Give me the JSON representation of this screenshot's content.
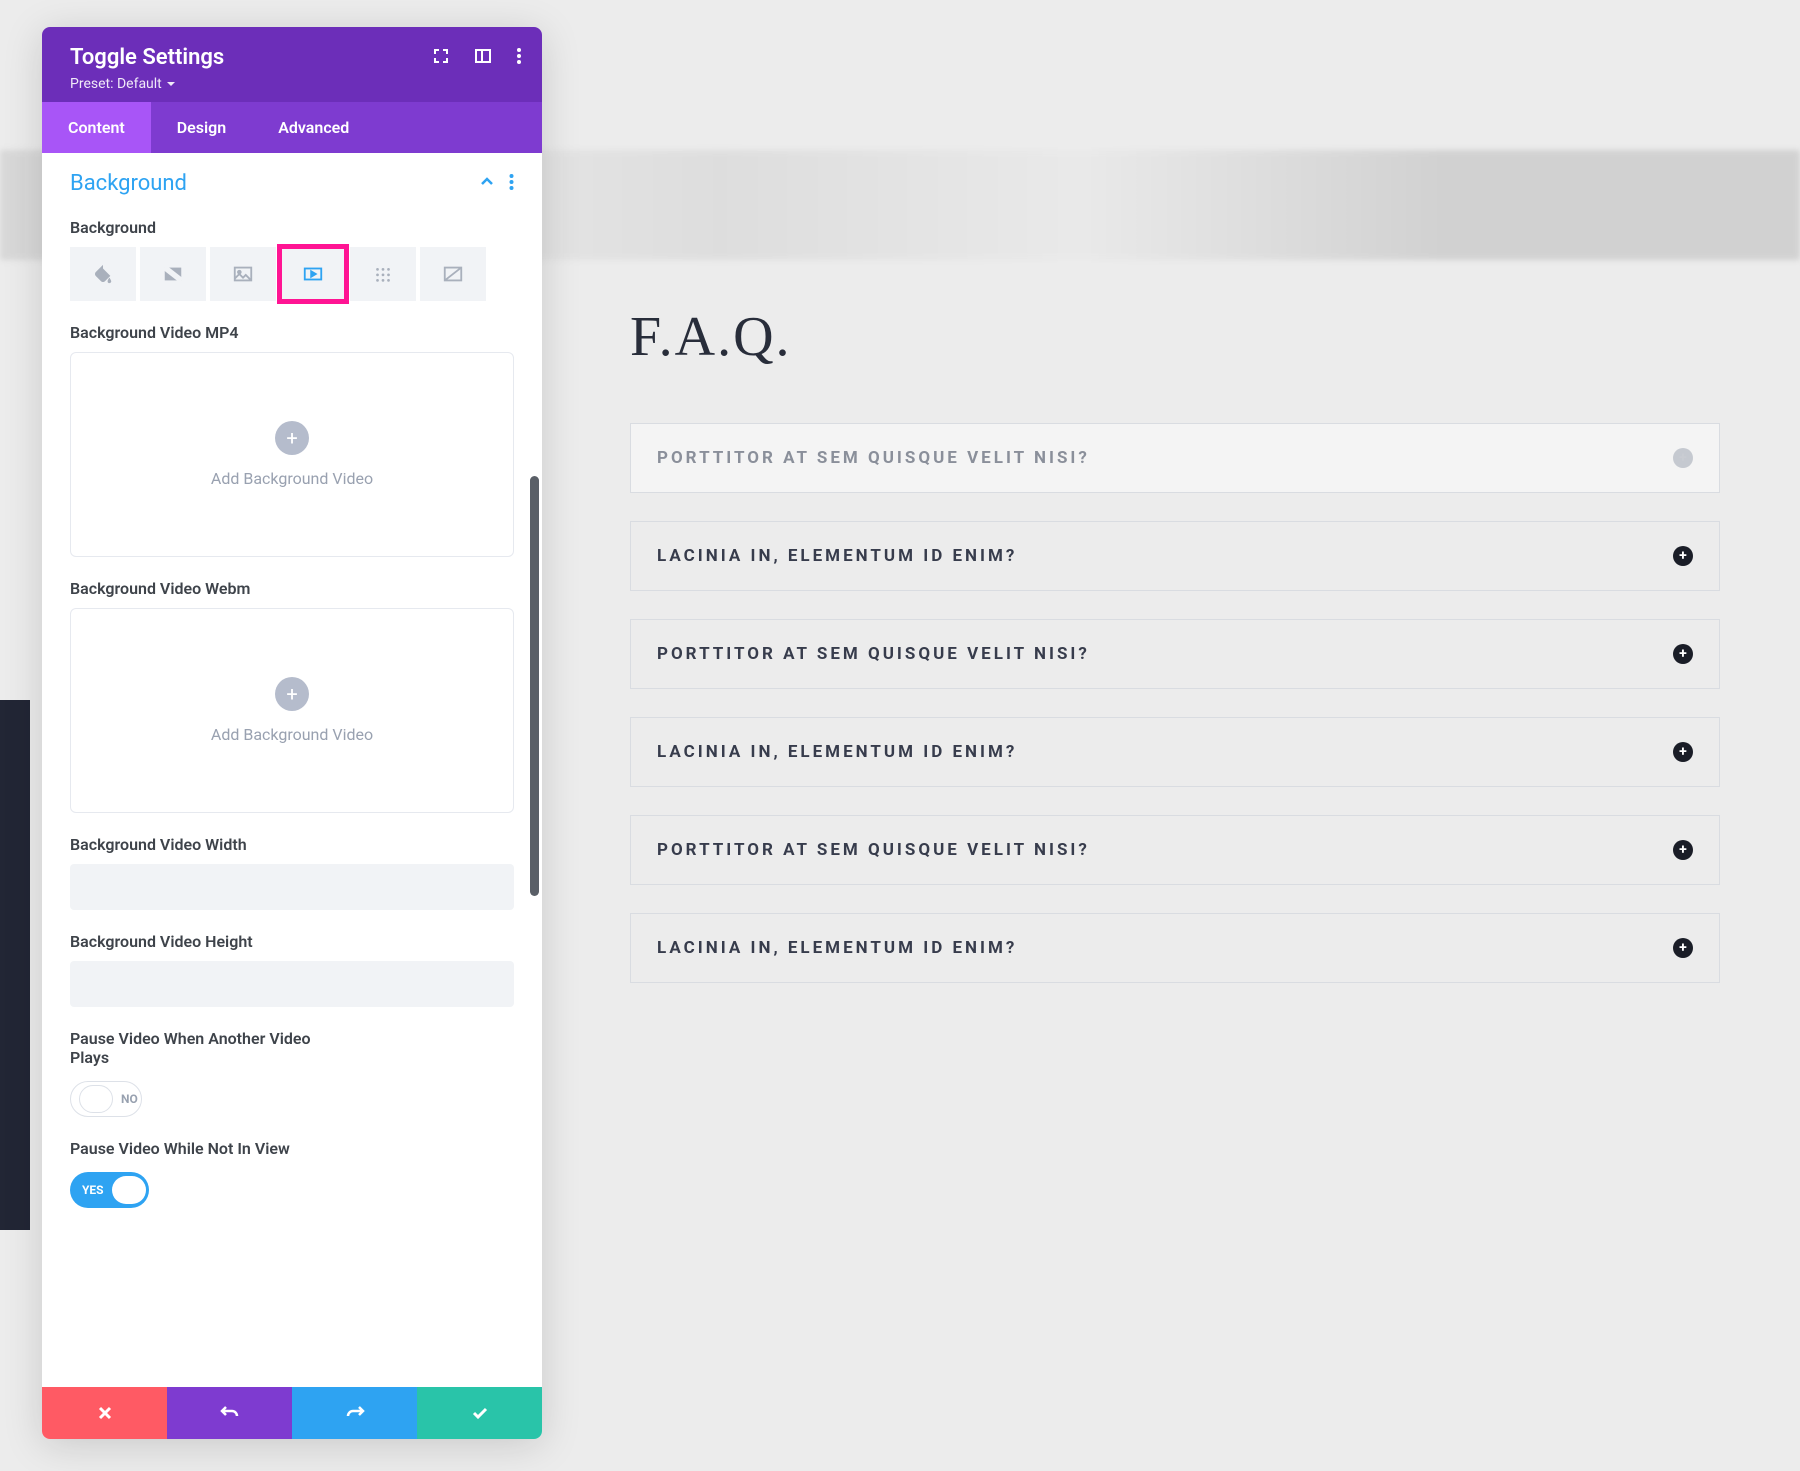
{
  "panel": {
    "title": "Toggle Settings",
    "preset": "Preset: Default",
    "tabs": [
      "Content",
      "Design",
      "Advanced"
    ],
    "section_title": "Background",
    "labels": {
      "background": "Background",
      "mp4": "Background Video MP4",
      "webm": "Background Video Webm",
      "width": "Background Video Width",
      "height": "Background Video Height",
      "pause_another": "Pause Video When Another Video Plays",
      "pause_view": "Pause Video While Not In View"
    },
    "dropzone": "Add Background Video",
    "toggles": {
      "no": "NO",
      "yes": "YES"
    }
  },
  "content": {
    "title": "F.A.Q.",
    "items": [
      {
        "q": "Porttitor at sem quisque velit nisi?",
        "selected": true
      },
      {
        "q": "Lacinia in, elementum id enim?",
        "selected": false
      },
      {
        "q": "Porttitor at sem quisque velit nisi?",
        "selected": false
      },
      {
        "q": "Lacinia in, elementum id enim?",
        "selected": false
      },
      {
        "q": "Porttitor at sem quisque velit nisi?",
        "selected": false
      },
      {
        "q": "Lacinia in, elementum id enim?",
        "selected": false
      }
    ]
  }
}
